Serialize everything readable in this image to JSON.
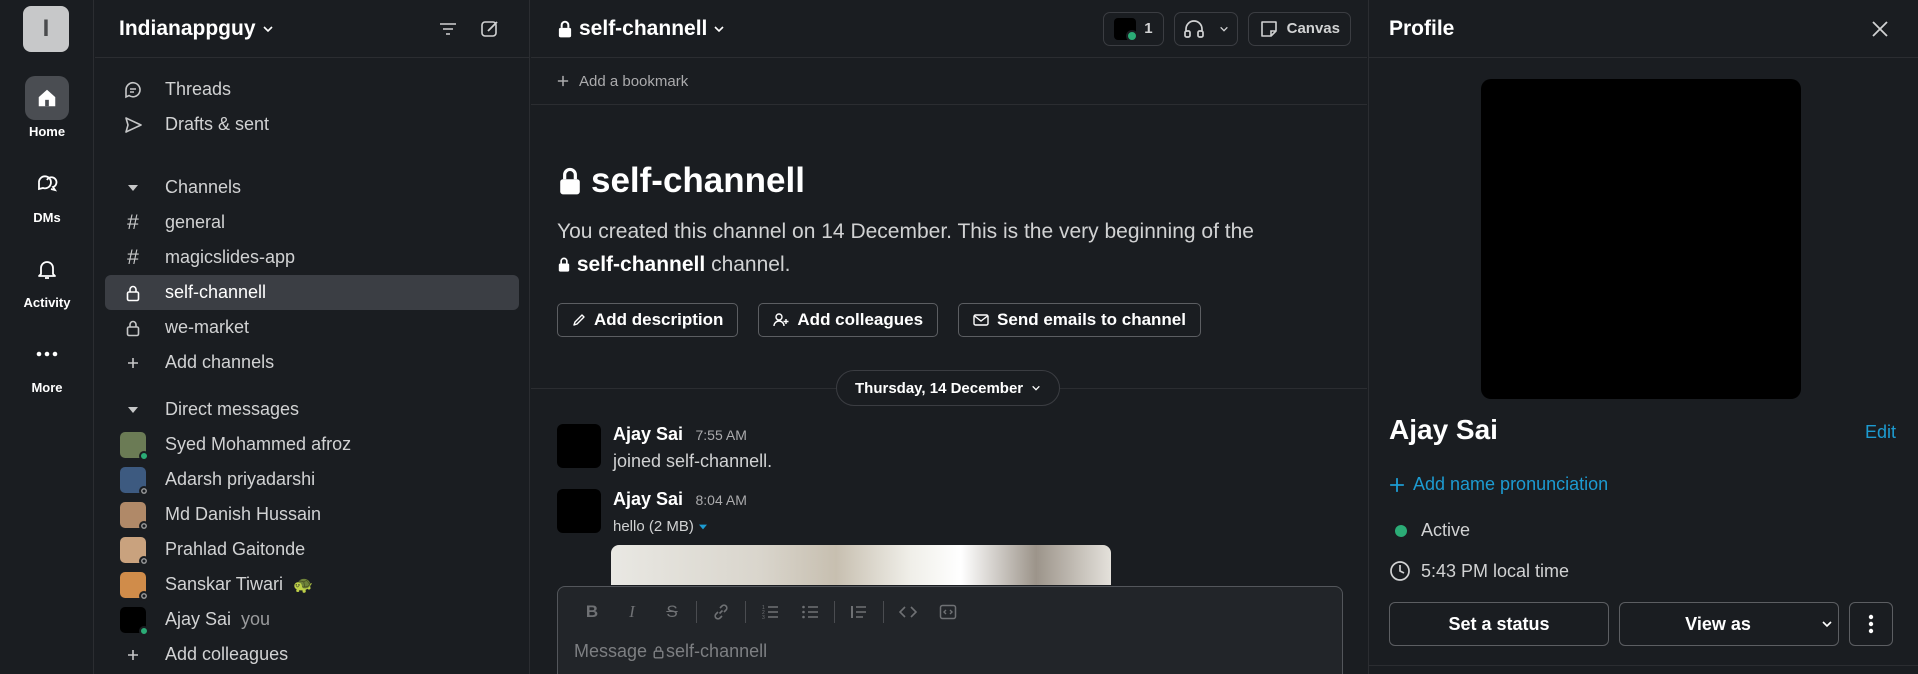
{
  "rail": {
    "workspace_initial": "I",
    "items": [
      {
        "label": "Home",
        "icon": "home-icon"
      },
      {
        "label": "DMs",
        "icon": "dms-icon"
      },
      {
        "label": "Activity",
        "icon": "bell-icon"
      },
      {
        "label": "More",
        "icon": "more-horizontal-icon"
      }
    ]
  },
  "sidebar": {
    "workspace_name": "Indianappguy",
    "top_items": [
      {
        "label": "Threads",
        "icon": "threads-icon"
      },
      {
        "label": "Drafts & sent",
        "icon": "send-icon"
      }
    ],
    "channels_section": "Channels",
    "channels": [
      {
        "label": "general",
        "private": false,
        "selected": false
      },
      {
        "label": "magicslides-app",
        "private": false,
        "selected": false
      },
      {
        "label": "self-channell",
        "private": true,
        "selected": true
      },
      {
        "label": "we-market",
        "private": true,
        "selected": false
      }
    ],
    "add_channels": "Add channels",
    "dm_section": "Direct messages",
    "dms": [
      {
        "label": "Syed Mohammed afroz",
        "online": true,
        "avatar_color": "#6b7b55"
      },
      {
        "label": "Adarsh priyadarshi",
        "online": false,
        "avatar_color": "#3d5a80"
      },
      {
        "label": "Md Danish Hussain",
        "online": false,
        "avatar_color": "#b08968"
      },
      {
        "label": "Prahlad Gaitonde",
        "online": false,
        "avatar_color": "#c9a27e"
      },
      {
        "label": "Sanskar Tiwari",
        "online": false,
        "avatar_color": "#d08c4a",
        "emoji": "🐢"
      },
      {
        "label": "Ajay Sai",
        "online": true,
        "avatar_color": "#000000",
        "suffix": "you"
      }
    ],
    "add_colleagues": "Add colleagues"
  },
  "channel": {
    "name": "self-channell",
    "member_count": "1",
    "canvas_label": "Canvas",
    "bookmark_label": "Add a bookmark",
    "intro_title": "self-channell",
    "intro_text_1": "You created this channel on 14 December. This is the very beginning of the",
    "intro_channel": "self-channell",
    "intro_text_2": "channel.",
    "buttons": {
      "add_description": "Add description",
      "add_colleagues": "Add colleagues",
      "send_emails": "Send emails to channel"
    },
    "date_divider": "Thursday, 14 December",
    "messages": [
      {
        "author": "Ajay Sai",
        "time": "7:55 AM",
        "text": "joined self-channell."
      },
      {
        "author": "Ajay Sai",
        "time": "8:04 AM",
        "text": "hello (2 MB)"
      }
    ],
    "composer_placeholder": "Message",
    "composer_channel": "self-channell"
  },
  "profile": {
    "title": "Profile",
    "name": "Ajay Sai",
    "edit": "Edit",
    "add_pronunciation": "Add name pronunciation",
    "status": "Active",
    "local_time": "5:43 PM local time",
    "set_status": "Set a status",
    "view_as": "View as"
  },
  "colors": {
    "background": "#1a1d21",
    "accent_link": "#1d9bd1",
    "online": "#2bac76",
    "selected_row": "#3b3e44"
  }
}
